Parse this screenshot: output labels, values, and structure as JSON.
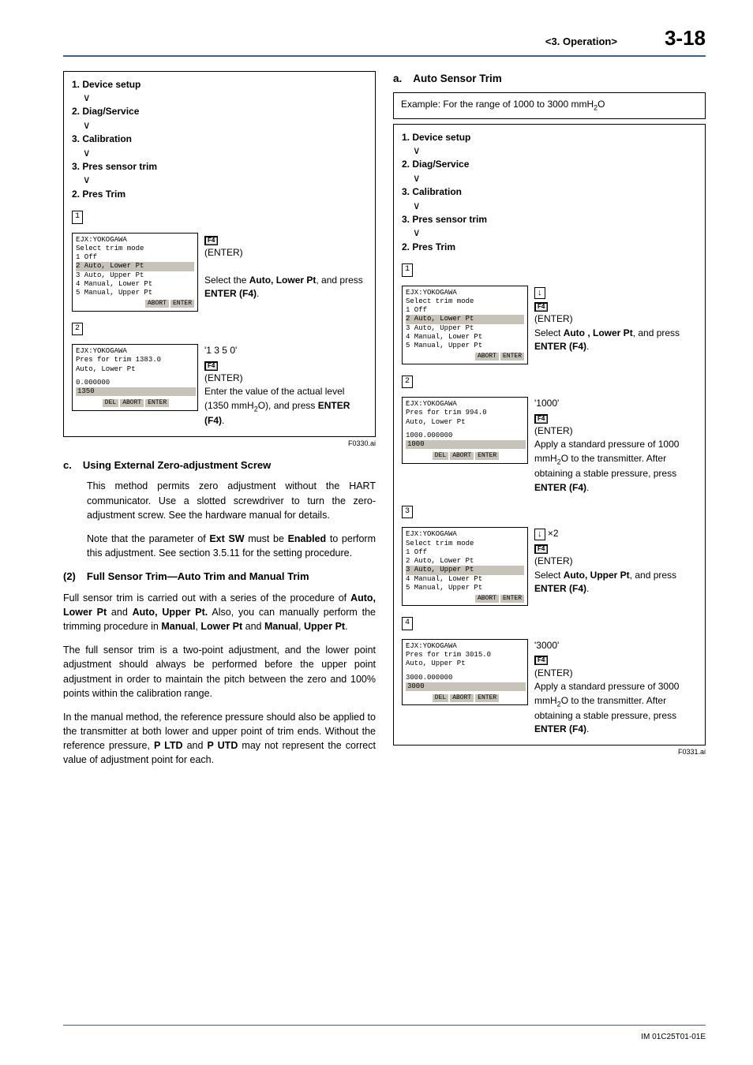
{
  "header": {
    "section": "<3. Operation>",
    "page": "3-18"
  },
  "left": {
    "crumbs": [
      "1. Device setup",
      "2. Diag/Service",
      "3. Calibration",
      "3. Pres sensor trim",
      "2. Pres Trim"
    ],
    "step1": {
      "num": "1",
      "scr": {
        "title": "EJX:YOKOGAWA",
        "sub": "Select trim mode",
        "items": [
          "1 Off",
          "2 Auto, Lower Pt",
          "3 Auto, Upper Pt",
          "4 Manual, Lower Pt",
          "5 Manual, Upper Pt"
        ],
        "hl": 1,
        "btns": [
          "ABORT",
          "ENTER"
        ]
      },
      "txt": {
        "key": "F4",
        "enter": "(ENTER)",
        "line1_a": "Select the ",
        "line1_bold": "Auto, Lower Pt",
        "line1_b": ", and press ",
        "line1_bold2": "ENTER (F4)",
        "line1_c": "."
      }
    },
    "step2": {
      "num": "2",
      "scr": {
        "title": "EJX:YOKOGAWA",
        "l2": "Pres for trim 1383.0",
        "l3": "Auto, Lower Pt",
        "val_top": "0.000000",
        "val": "1350",
        "btns": [
          "DEL",
          "ABORT",
          "ENTER"
        ]
      },
      "txt": {
        "quote": "'1 3 5 0'",
        "key": "F4",
        "enter": "(ENTER)",
        "line_a": "Enter the value of the actual level (1350 mmH",
        "line_b": "O), and press ",
        "line_bold": "ENTER (F4)",
        "line_c": "."
      }
    },
    "figid": "F0330.ai",
    "sec_c": {
      "lbl": "c.",
      "title": "Using External Zero-adjustment Screw",
      "p1": "This method permits zero adjustment without the HART communicator. Use a slotted screwdriver to turn the zero-adjustment screw. See the hardware manual for details.",
      "p2_a": "Note that the parameter of ",
      "p2_bold_1": "Ext SW",
      "p2_b": " must be ",
      "p2_bold_2": "Enabled",
      "p2_c": " to perform this adjustment. See section 3.5.11 for the setting procedure."
    },
    "sec_2": {
      "lbl": "(2)",
      "title": "Full Sensor Trim—Auto Trim and Manual Trim",
      "p1_a": "Full sensor trim is carried out with a series of the procedure of ",
      "p1_b1": "Auto, Lower Pt",
      "p1_b": " and ",
      "p1_b2": "Auto, Upper Pt.",
      "p1_c": " Also, you can manually perform the trimming procedure in ",
      "p1_b3": "Manual",
      "p1_d": ", ",
      "p1_b4": "Lower Pt",
      "p1_e": " and ",
      "p1_b5": "Manual",
      "p1_f": ", ",
      "p1_b6": "Upper Pt",
      "p1_g": ".",
      "p2": "The full sensor trim is a two-point adjustment, and the lower point adjustment should always be performed before the upper point adjustment in order to maintain the pitch between the zero and 100% points within the calibration range.",
      "p3_a": "In the manual method, the reference pressure should also be applied to the transmitter at both lower and upper point of trim ends. Without the reference pressure, ",
      "p3_b1": "P LTD",
      "p3_b": " and ",
      "p3_b2": "P UTD",
      "p3_c": " may not represent the correct value of adjustment point for each."
    }
  },
  "right": {
    "heading": {
      "lbl": "a.",
      "title": "Auto Sensor Trim"
    },
    "example_a": "Example:  For the range of 1000 to 3000 mmH",
    "example_b": "O",
    "crumbs": [
      "1. Device setup",
      "2. Diag/Service",
      "3. Calibration",
      "3. Pres sensor trim",
      "2. Pres Trim"
    ],
    "step1": {
      "num": "1",
      "scr": {
        "title": "EJX:YOKOGAWA",
        "sub": "Select trim mode",
        "items": [
          "1 Off",
          "2 Auto, Lower Pt",
          "3 Auto, Upper Pt",
          "4 Manual, Lower Pt",
          "5 Manual, Upper Pt"
        ],
        "hl": 1,
        "btns": [
          "ABORT",
          "ENTER"
        ]
      },
      "txt": {
        "arrow": "↓",
        "key": "F4",
        "enter": "(ENTER)",
        "a": "Select ",
        "b1": "Auto , Lower Pt",
        "b": ", and press ",
        "b2": "ENTER (F4)",
        "c": "."
      }
    },
    "step2": {
      "num": "2",
      "scr": {
        "title": "EJX:YOKOGAWA",
        "l2": "Pres for trim 994.0",
        "l3": "Auto, Lower Pt",
        "val_top": "1000.000000",
        "val": "1000",
        "btns": [
          "DEL",
          "ABORT",
          "ENTER"
        ]
      },
      "txt": {
        "quote": "'1000'",
        "key": "F4",
        "enter": "(ENTER)",
        "a": "Apply a standard pressure of 1000 mmH",
        "b": "O to the transmitter. After obtaining a stable pressure, press ",
        "bold": "ENTER (F4)",
        "c": "."
      }
    },
    "step3": {
      "num": "3",
      "scr": {
        "title": "EJX:YOKOGAWA",
        "sub": "Select trim mode",
        "items": [
          "1 Off",
          "2 Auto, Lower Pt",
          "3 Auto, Upper Pt",
          "4 Manual, Lower Pt",
          "5 Manual, Upper Pt"
        ],
        "hl": 2,
        "btns": [
          "ABORT",
          "ENTER"
        ]
      },
      "txt": {
        "arrow": "↓",
        "x2": "×2",
        "key": "F4",
        "enter": "(ENTER)",
        "a": "Select ",
        "b1": "Auto, Upper Pt",
        "b": ", and press ",
        "b2": "ENTER (F4)",
        "c": "."
      }
    },
    "step4": {
      "num": "4",
      "scr": {
        "title": "EJX:YOKOGAWA",
        "l2": "Pres for trim 3015.0",
        "l3": "Auto, Upper Pt",
        "val_top": "3000.000000",
        "val": "3000",
        "btns": [
          "DEL",
          "ABORT",
          "ENTER"
        ]
      },
      "txt": {
        "quote": "'3000'",
        "key": "F4",
        "enter": "(ENTER)",
        "a": "Apply a standard pressure of 3000 mmH",
        "b": "O to the transmitter. After obtaining a stable pressure, press ",
        "bold": "ENTER (F4)",
        "c": "."
      }
    },
    "figid": "F0331.ai"
  },
  "footer": "IM 01C25T01-01E"
}
